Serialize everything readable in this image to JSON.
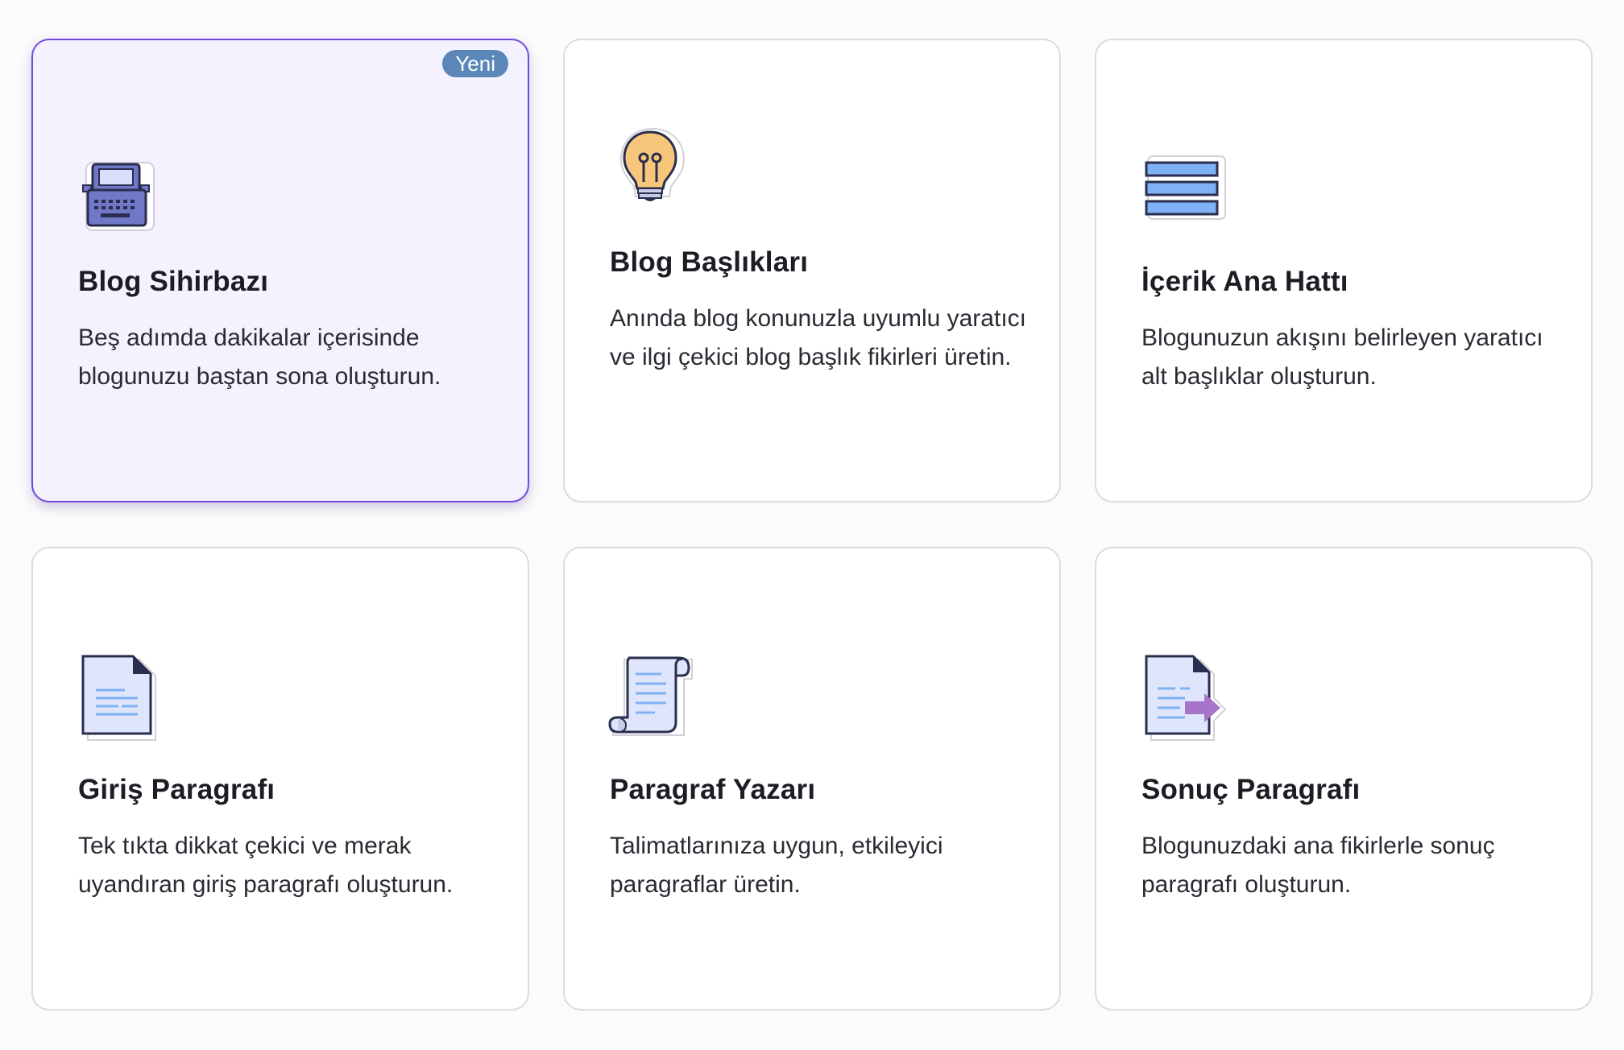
{
  "cards": [
    {
      "title": "Blog Sihirbazı",
      "description": "Beş adımda dakikalar içerisinde blogunuzu baştan sona oluşturun.",
      "badge": "Yeni",
      "icon": "typewriter-icon",
      "selected": true
    },
    {
      "title": "Blog Başlıkları",
      "description": "Anında blog konunuzla uyumlu yaratıcı ve ilgi çekici blog başlık fikirleri üretin.",
      "icon": "lightbulb-icon",
      "selected": false
    },
    {
      "title": "İçerik Ana Hattı",
      "description": "Blogunuzun akışını belirleyen yaratıcı alt başlıklar oluşturun.",
      "icon": "outline-list-icon",
      "selected": false
    },
    {
      "title": "Giriş Paragrafı",
      "description": "Tek tıkta dikkat çekici ve merak uyandıran giriş paragrafı oluşturun.",
      "icon": "document-icon",
      "selected": false
    },
    {
      "title": "Paragraf Yazarı",
      "description": "Talimatlarınıza uygun, etkileyici paragraflar üretin.",
      "icon": "scroll-icon",
      "selected": false
    },
    {
      "title": "Sonuç Paragrafı",
      "description": "Blogunuzdaki ana fikirlerle sonuç paragrafı oluşturun.",
      "icon": "document-export-icon",
      "selected": false
    }
  ],
  "colors": {
    "accent_border": "#7349e0",
    "selected_background": "#f4f2fe",
    "badge_background": "#5a86b8"
  }
}
